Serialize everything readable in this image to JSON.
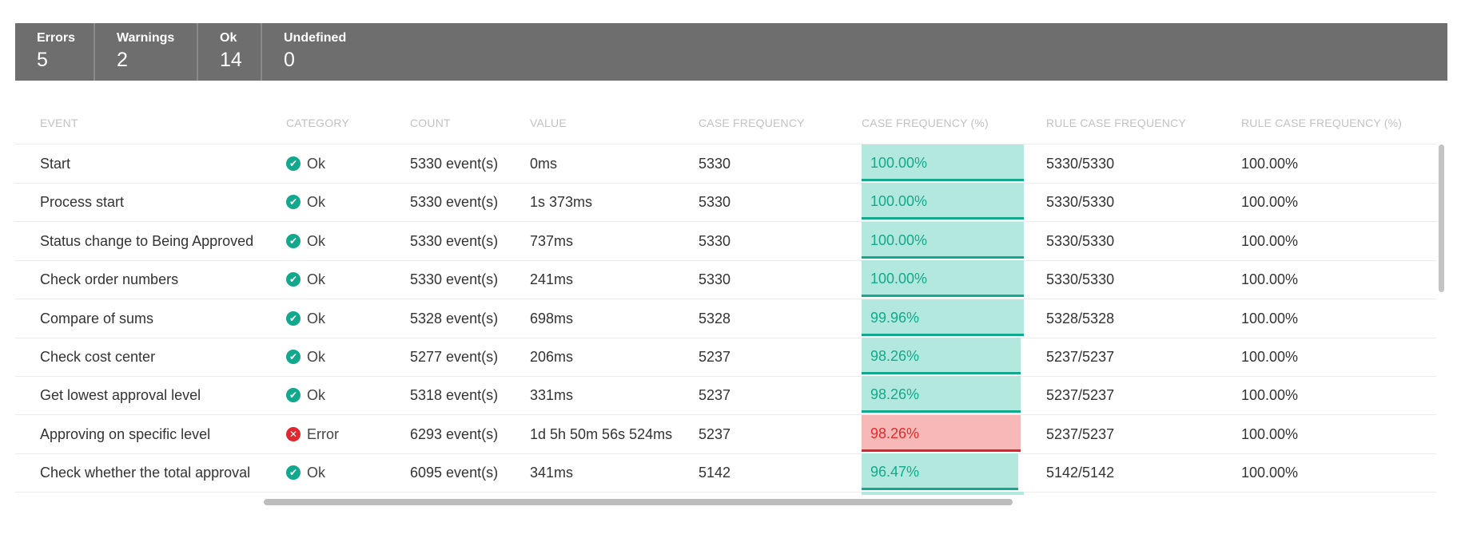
{
  "summary": [
    {
      "label": "Errors",
      "value": "5"
    },
    {
      "label": "Warnings",
      "value": "2"
    },
    {
      "label": "Ok",
      "value": "14"
    },
    {
      "label": "Undefined",
      "value": "0"
    }
  ],
  "columns": [
    "EVENT",
    "CATEGORY",
    "COUNT",
    "VALUE",
    "CASE FREQUENCY",
    "CASE FREQUENCY (%)",
    "RULE CASE FREQUENCY",
    "RULE CASE FREQUENCY (%)"
  ],
  "rows": [
    {
      "event": "Start",
      "category": "Ok",
      "status": "ok",
      "count": "5330 event(s)",
      "value": "0ms",
      "case_freq": "5330",
      "case_freq_pct": "100.00%",
      "case_freq_fraction": 1.0,
      "rule_case_freq": "5330/5330",
      "rule_case_freq_pct": "100.00%"
    },
    {
      "event": "Process start",
      "category": "Ok",
      "status": "ok",
      "count": "5330 event(s)",
      "value": "1s 373ms",
      "case_freq": "5330",
      "case_freq_pct": "100.00%",
      "case_freq_fraction": 1.0,
      "rule_case_freq": "5330/5330",
      "rule_case_freq_pct": "100.00%"
    },
    {
      "event": "Status change to Being Approved",
      "category": "Ok",
      "status": "ok",
      "count": "5330 event(s)",
      "value": "737ms",
      "case_freq": "5330",
      "case_freq_pct": "100.00%",
      "case_freq_fraction": 1.0,
      "rule_case_freq": "5330/5330",
      "rule_case_freq_pct": "100.00%"
    },
    {
      "event": "Check order numbers",
      "category": "Ok",
      "status": "ok",
      "count": "5330 event(s)",
      "value": "241ms",
      "case_freq": "5330",
      "case_freq_pct": "100.00%",
      "case_freq_fraction": 1.0,
      "rule_case_freq": "5330/5330",
      "rule_case_freq_pct": "100.00%"
    },
    {
      "event": "Compare of sums",
      "category": "Ok",
      "status": "ok",
      "count": "5328 event(s)",
      "value": "698ms",
      "case_freq": "5328",
      "case_freq_pct": "99.96%",
      "case_freq_fraction": 0.9996,
      "rule_case_freq": "5328/5328",
      "rule_case_freq_pct": "100.00%"
    },
    {
      "event": "Check cost center",
      "category": "Ok",
      "status": "ok",
      "count": "5277 event(s)",
      "value": "206ms",
      "case_freq": "5237",
      "case_freq_pct": "98.26%",
      "case_freq_fraction": 0.9826,
      "rule_case_freq": "5237/5237",
      "rule_case_freq_pct": "100.00%"
    },
    {
      "event": "Get lowest approval level",
      "category": "Ok",
      "status": "ok",
      "count": "5318 event(s)",
      "value": "331ms",
      "case_freq": "5237",
      "case_freq_pct": "98.26%",
      "case_freq_fraction": 0.9826,
      "rule_case_freq": "5237/5237",
      "rule_case_freq_pct": "100.00%"
    },
    {
      "event": "Approving on specific level",
      "category": "Error",
      "status": "error",
      "count": "6293 event(s)",
      "value": "1d 5h 50m 56s 524ms",
      "case_freq": "5237",
      "case_freq_pct": "98.26%",
      "case_freq_fraction": 0.9826,
      "rule_case_freq": "5237/5237",
      "rule_case_freq_pct": "100.00%"
    },
    {
      "event": "Check whether the total approval",
      "category": "Ok",
      "status": "ok",
      "count": "6095 event(s)",
      "value": "341ms",
      "case_freq": "5142",
      "case_freq_pct": "96.47%",
      "case_freq_fraction": 0.9647,
      "rule_case_freq": "5142/5142",
      "rule_case_freq_pct": "100.00%"
    }
  ],
  "colors": {
    "ok": "#11a88e",
    "error": "#e0282e",
    "ok_fill": "#b2e8dd",
    "error_fill": "#f7b8b8"
  },
  "icons": {
    "ok": "check-circle-icon",
    "error": "x-circle-icon"
  }
}
